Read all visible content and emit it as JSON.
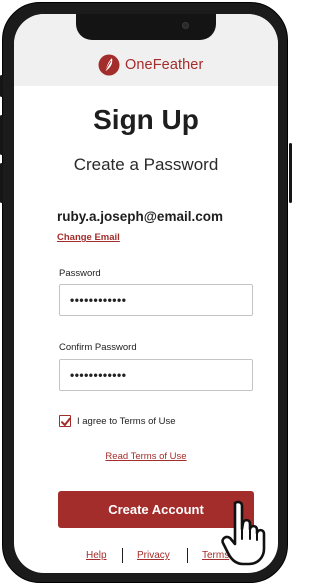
{
  "brand": {
    "name": "OneFeather",
    "color": "#a32d2b"
  },
  "page": {
    "title": "Sign Up",
    "subtitle": "Create a Password"
  },
  "account": {
    "email": "ruby.a.joseph@email.com",
    "change_email_label": "Change Email"
  },
  "form": {
    "password_label": "Password",
    "password_value": "••••••••••••",
    "confirm_label": "Confirm Password",
    "confirm_value": "••••••••••••",
    "agree_checked": true,
    "agree_label": "I agree to Terms of Use",
    "read_terms_label": "Read Terms of Use",
    "submit_label": "Create Account"
  },
  "footer": {
    "links": [
      "Help",
      "Privacy",
      "Terms"
    ]
  },
  "icons": [
    "feather-logo-icon",
    "checkmark-icon",
    "pointer-hand-icon"
  ]
}
